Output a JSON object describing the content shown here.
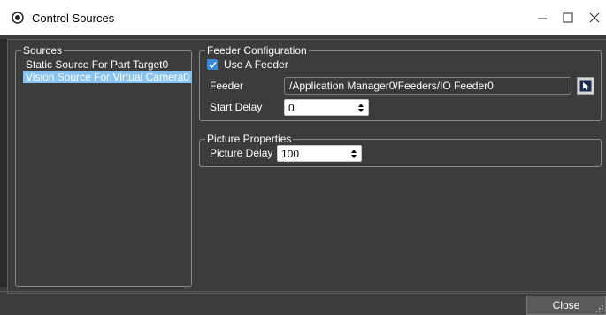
{
  "window": {
    "title": "Control Sources",
    "app_icon": "record-icon",
    "controls": {
      "minimize": "—",
      "maximize": "☐",
      "close": "✕"
    }
  },
  "sources": {
    "legend": "Sources",
    "items": [
      {
        "label": "Static Source For Part Target0",
        "selected": false
      },
      {
        "label": "Vision Source For Virtual Camera0",
        "selected": true
      }
    ]
  },
  "feeder_config": {
    "legend": "Feeder Configuration",
    "use_feeder_label": "Use A Feeder",
    "use_feeder_checked": true,
    "feeder_label": "Feeder",
    "feeder_value": "/Application Manager0/Feeders/IO Feeder0",
    "start_delay_label": "Start Delay",
    "start_delay_value": "0",
    "browse_icon": "cursor-select-icon"
  },
  "picture_props": {
    "legend": "Picture Properties",
    "picture_delay_label": "Picture Delay",
    "picture_delay_value": "100"
  },
  "footer": {
    "close_label": "Close"
  },
  "colors": {
    "selection": "#88c2f0",
    "background": "#3c3c3c",
    "checkbox_accent": "#3b8ad8"
  }
}
